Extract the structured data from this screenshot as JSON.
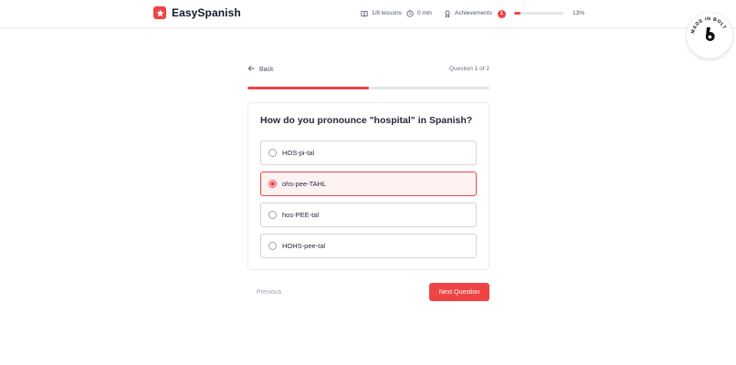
{
  "app": {
    "name": "EasySpanish",
    "brand_color": "#ef4444"
  },
  "header": {
    "lessons": "1/8 lessons",
    "time": "0 min",
    "achievements_label": "Achievements",
    "achievements_count": "1",
    "progress_percent_label": "13%",
    "progress_fraction": 0.13
  },
  "bolt_badge": {
    "text": "MADE IN BOLT"
  },
  "quiz": {
    "back_label": "Back",
    "question_counter": "Question 1 of 2",
    "progress_fraction": 0.5,
    "question": "How do you pronounce \"hospital\" in Spanish?",
    "options": [
      {
        "label": "HOS-pi-tal",
        "selected": false
      },
      {
        "label": "ohs-pee-TAHL",
        "selected": true
      },
      {
        "label": "hos-PEE-tal",
        "selected": false
      },
      {
        "label": "HOHS-pee-tal",
        "selected": false
      }
    ],
    "previous_label": "Previous",
    "next_label": "Next Question"
  }
}
